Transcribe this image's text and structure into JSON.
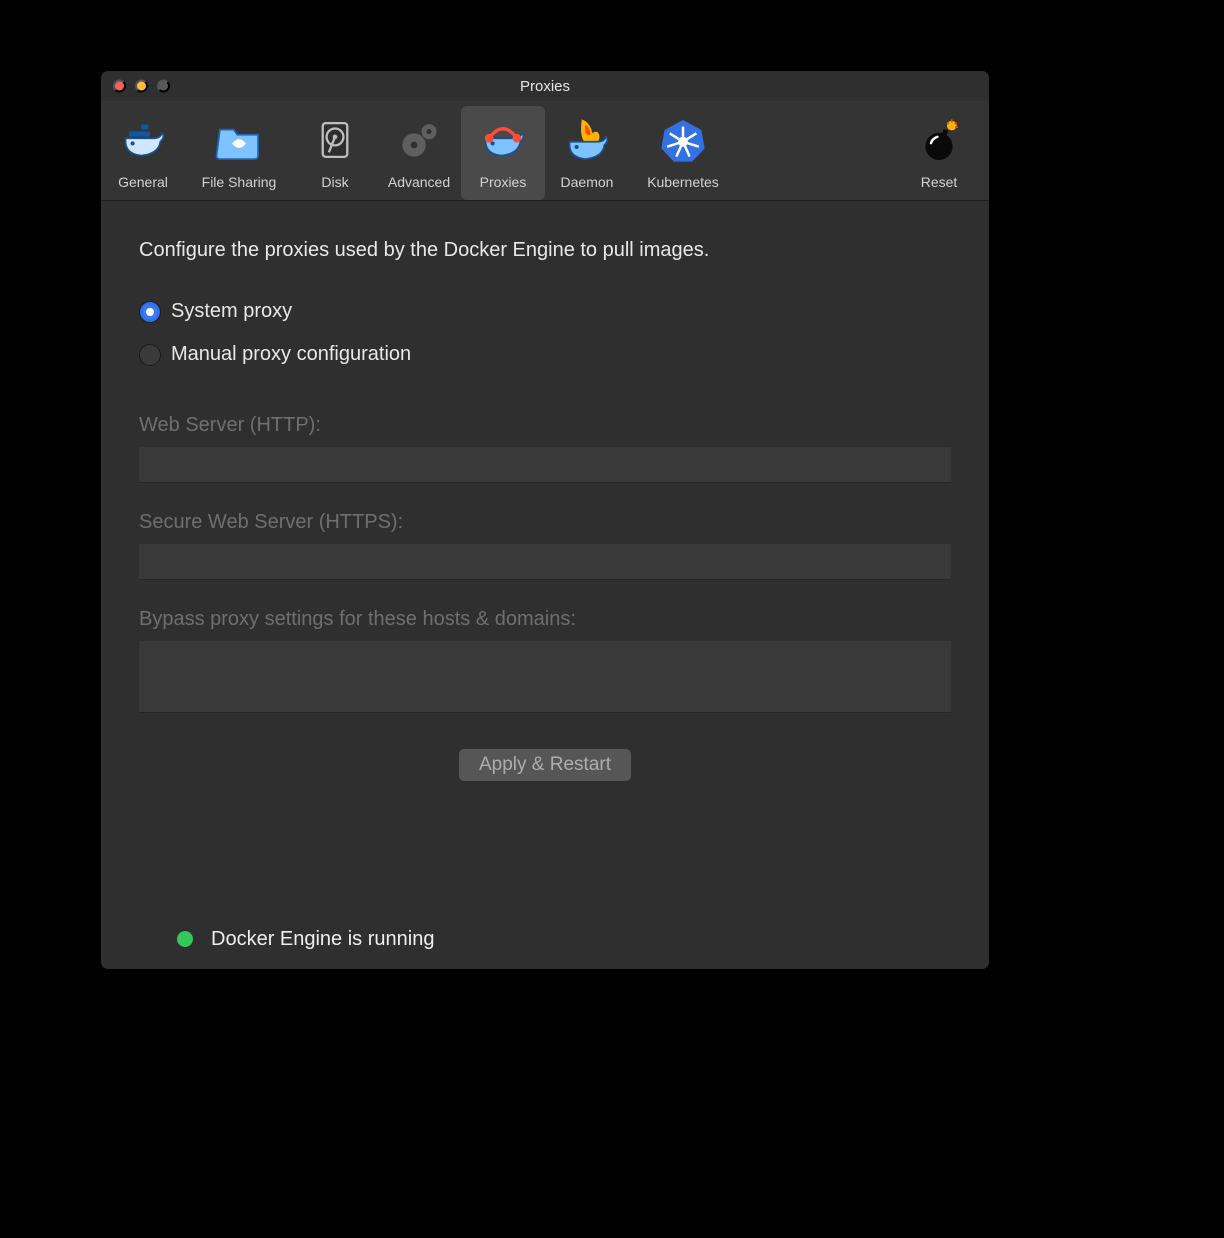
{
  "window": {
    "title": "Proxies"
  },
  "toolbar": {
    "items": [
      {
        "id": "general",
        "label": "General"
      },
      {
        "id": "filesharing",
        "label": "File Sharing"
      },
      {
        "id": "disk",
        "label": "Disk"
      },
      {
        "id": "advanced",
        "label": "Advanced"
      },
      {
        "id": "proxies",
        "label": "Proxies",
        "selected": true
      },
      {
        "id": "daemon",
        "label": "Daemon"
      },
      {
        "id": "kubernetes",
        "label": "Kubernetes"
      }
    ],
    "reset_label": "Reset"
  },
  "content": {
    "description": "Configure the proxies used by the Docker Engine to pull images.",
    "radios": {
      "system_label": "System proxy",
      "manual_label": "Manual proxy configuration",
      "selected": "system"
    },
    "fields": {
      "http": {
        "label": "Web Server (HTTP):",
        "value": ""
      },
      "https": {
        "label": "Secure Web Server (HTTPS):",
        "value": ""
      },
      "bypass": {
        "label": "Bypass proxy settings for these hosts & domains:",
        "value": ""
      }
    },
    "apply_label": "Apply & Restart"
  },
  "status": {
    "text": "Docker Engine is running",
    "color": "#34c759"
  }
}
